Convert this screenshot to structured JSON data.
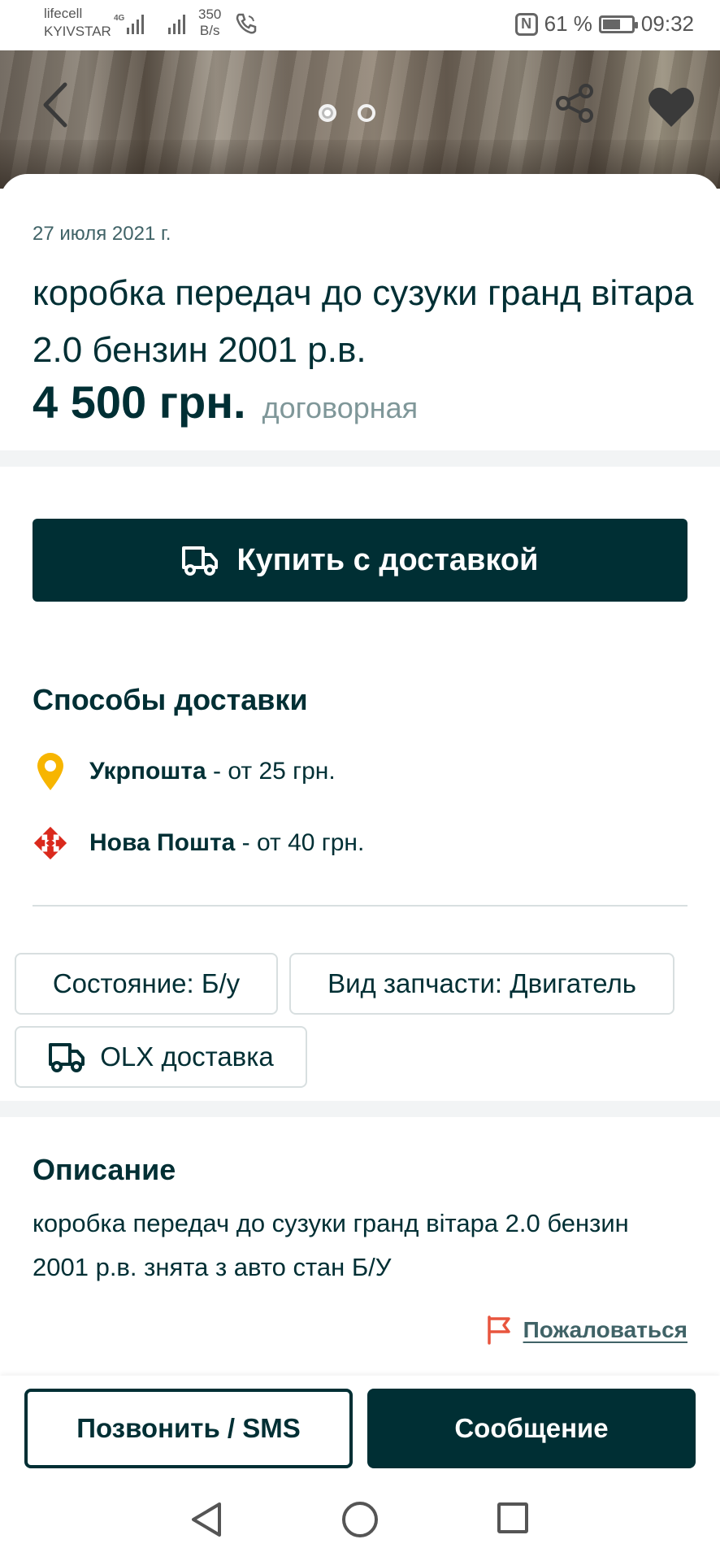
{
  "status_bar": {
    "carrier1": "lifecell",
    "carrier2": "KYIVSTAR",
    "network_badge": "4G",
    "speed_value": "350",
    "speed_unit": "B/s",
    "battery": "61 %",
    "battery_level": 0.61,
    "time": "09:32"
  },
  "gallery": {
    "page_count": 2,
    "current_page": 1
  },
  "listing": {
    "date": "27 июля 2021 г.",
    "title": "коробка передач до сузуки гранд вітара 2.0 бензин 2001 р.в.",
    "price": "4 500 грн.",
    "price_note": "договорная"
  },
  "buy_button": {
    "label": "Купить с доставкой"
  },
  "delivery": {
    "heading": "Способы доставки",
    "options": [
      {
        "name": "Укрпошта",
        "price": " - от 25 грн.",
        "icon": "ukrposhta-pin-icon",
        "color": "#f7b500"
      },
      {
        "name": "Нова Пошта",
        "price": " - от 40 грн.",
        "icon": "nova-poshta-icon",
        "color": "#da291c"
      }
    ]
  },
  "params": {
    "condition": "Состояние: Б/у",
    "part_type": "Вид запчасти: Двигатель",
    "olx_delivery": "OLX доставка"
  },
  "description": {
    "heading": "Описание",
    "text": "коробка передач до сузуки гранд вітара 2.0 бензин 2001 р.в. знята з авто стан Б/У"
  },
  "report": {
    "label": "Пожаловаться",
    "icon_color": "#e8553e"
  },
  "actions": {
    "call_label": "Позвонить / SMS",
    "message_label": "Сообщение"
  },
  "colors": {
    "primary": "#002f34",
    "muted": "#7f9799",
    "separator": "#f2f4f5"
  }
}
